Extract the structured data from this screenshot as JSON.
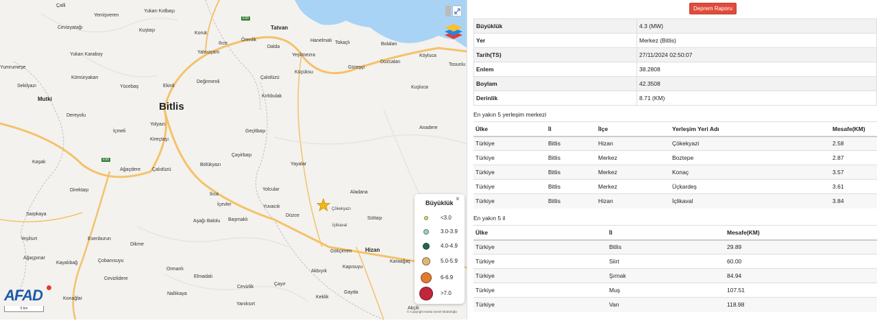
{
  "colors": {
    "lake": "#a9d3f5",
    "road_major": "#f5c16a",
    "road_minor": "#ffffff",
    "border": "#c9b9cf",
    "report_button": "#e04b3b",
    "epicenter_star": "#f2b619",
    "afad_blue": "#1e5aa8"
  },
  "map": {
    "places": {
      "bitlis": "Bitlis",
      "tatvan": "Tatvan",
      "hizan": "Hizan",
      "mutki": "Mutki",
      "cali": "Çalli",
      "yemisveren": "Yemişveren",
      "yukari_kolbasi": "Yukarı Kolbaşı",
      "cevizyatagi": "Cevizyatağı",
      "kustasi": "Kuştaşı",
      "koruk": "Koruk",
      "ilice": "Ilıce",
      "orenlik": "Örenlik",
      "dalda": "Dalda",
      "hanelmali": "Hanelmalı",
      "tokacli": "Tokaçlı",
      "bolalan": "Bolalan",
      "koyluca": "Köyluca",
      "yalnizcam": "Yalnızçam",
      "yesilmezra": "Yeşilmezra",
      "yukari_karaboy": "Yukarı Karaboy",
      "komuryakan": "Kömüryakan",
      "sekilyazi": "Sekilyazı",
      "tosunlu": "Tosunlu",
      "kucuksu": "Küçüksu",
      "guresci": "Güreşçi",
      "dozcalan": "Dozcalan",
      "yucebas": "Yücebaş",
      "ekinli": "Ekinli",
      "degirmenli": "Değirmenli",
      "calidizu": "Çalıdüzü",
      "kuscla": "Kuşluca",
      "kirkbulak": "Kırkbulak",
      "dereyolu": "Dereyolu",
      "icmeli": "İçmeli",
      "yolyazi": "Yolyazı",
      "kirectasi": "Kireçtaşı",
      "gecitbasi": "Geçitbaşı",
      "anadere": "Anadere",
      "kasak": "Kaşak",
      "agacdere": "Ağaçdere",
      "calidizu2": "Çalıdüzü",
      "bolukyazi": "Bölükyazı",
      "cayirbasi": "Çayirbaşı",
      "yayalar": "Yayalar",
      "direktasi": "Direktaşı",
      "yolcular": "Yolcular",
      "aladana": "Aladana",
      "sarpkaya": "Sarpkaya",
      "ilica": "Ilıca",
      "icevler": "İçevler",
      "yuvacik": "Yuvacık",
      "cokekyazi": "Çökekyazı",
      "asagi_balolu": "Aşağı Balolu",
      "basmakli": "Başmaklı",
      "duzce": "Düzce",
      "suttasi": "Süttaşı",
      "iclikaval": "İçlikaval",
      "yesilsirt": "Yeşilsırt",
      "esenburun": "Esenburun",
      "dikme": "Dikme",
      "gokcimen": "Gökçimen",
      "agacpinar": "Ağaçpınar",
      "kayalibag": "Kayalıbağ",
      "cobanisuyu": "Çobanısuyu",
      "ormanli": "Ormanlı",
      "akbiyik": "Akbıyık",
      "kapisuyu": "Kapısuyu",
      "karaagac": "Karaağaç",
      "cevizlidere": "Cevizlidere",
      "elmadali": "Elmadalı",
      "cevizlik": "Cevizlik",
      "cayir": "Çayır",
      "konaglar": "Konağlar",
      "nallikaya": "Nallıkaya",
      "yaniksirt": "Yanıksırt",
      "keklik": "Keklik",
      "gayda": "Gayda",
      "akcik": "Akçik",
      "rumeli": "Yumrumeşe"
    },
    "shields": [
      "E99",
      "E99"
    ],
    "legend": {
      "title": "Büyüklük",
      "close": "×",
      "items": [
        {
          "label": "<3.0",
          "color": "#c8e36b"
        },
        {
          "label": "3.0-3.9",
          "color": "#9fd3b7"
        },
        {
          "label": "4.0-4.9",
          "color": "#1f6b4a"
        },
        {
          "label": "5.0-5.9",
          "color": "#e2b575"
        },
        {
          "label": "6-6.9",
          "color": "#e07b31"
        },
        {
          "label": ">7.0",
          "color": "#c0273b"
        }
      ]
    },
    "logo": "AFAD",
    "scale": "5 km",
    "attribution": "© Copyright Harita Genel Müdürlüğü"
  },
  "report_button": "Deprem Raporu",
  "details": [
    {
      "key": "Büyüklük",
      "value": "4.3 (MW)"
    },
    {
      "key": "Yer",
      "value": "Merkez (Bitlis)"
    },
    {
      "key": "Tarih(TS)",
      "value": "27/11/2024 02:50:07"
    },
    {
      "key": "Enlem",
      "value": "38.2808"
    },
    {
      "key": "Boylam",
      "value": "42.3508"
    },
    {
      "key": "Derinlik",
      "value": "8.71 (KM)"
    }
  ],
  "settlements": {
    "title": "En yakın 5 yerleşim merkezi",
    "headers": [
      "Ülke",
      "İl",
      "İlçe",
      "Yerleşim Yeri Adı",
      "Mesafe(KM)"
    ],
    "rows": [
      [
        "Türkiye",
        "Bitlis",
        "Hizan",
        "Çökekyazi",
        "2.58"
      ],
      [
        "Türkiye",
        "Bitlis",
        "Merkez",
        "Boztepe",
        "2.87"
      ],
      [
        "Türkiye",
        "Bitlis",
        "Merkez",
        "Konaç",
        "3.57"
      ],
      [
        "Türkiye",
        "Bitlis",
        "Merkez",
        "Üçkardeş",
        "3.61"
      ],
      [
        "Türkiye",
        "Bitlis",
        "Hizan",
        "İçlikaval",
        "3.84"
      ]
    ]
  },
  "provinces": {
    "title": "En yakın 5 il",
    "headers": [
      "Ülke",
      "İl",
      "Mesafe(KM)"
    ],
    "rows": [
      [
        "Türkiye",
        "Bitlis",
        "29.89"
      ],
      [
        "Türkiye",
        "Siirt",
        "60.00"
      ],
      [
        "Türkiye",
        "Şırnak",
        "84.94"
      ],
      [
        "Türkiye",
        "Muş",
        "107.51"
      ],
      [
        "Türkiye",
        "Van",
        "118.98"
      ]
    ]
  }
}
